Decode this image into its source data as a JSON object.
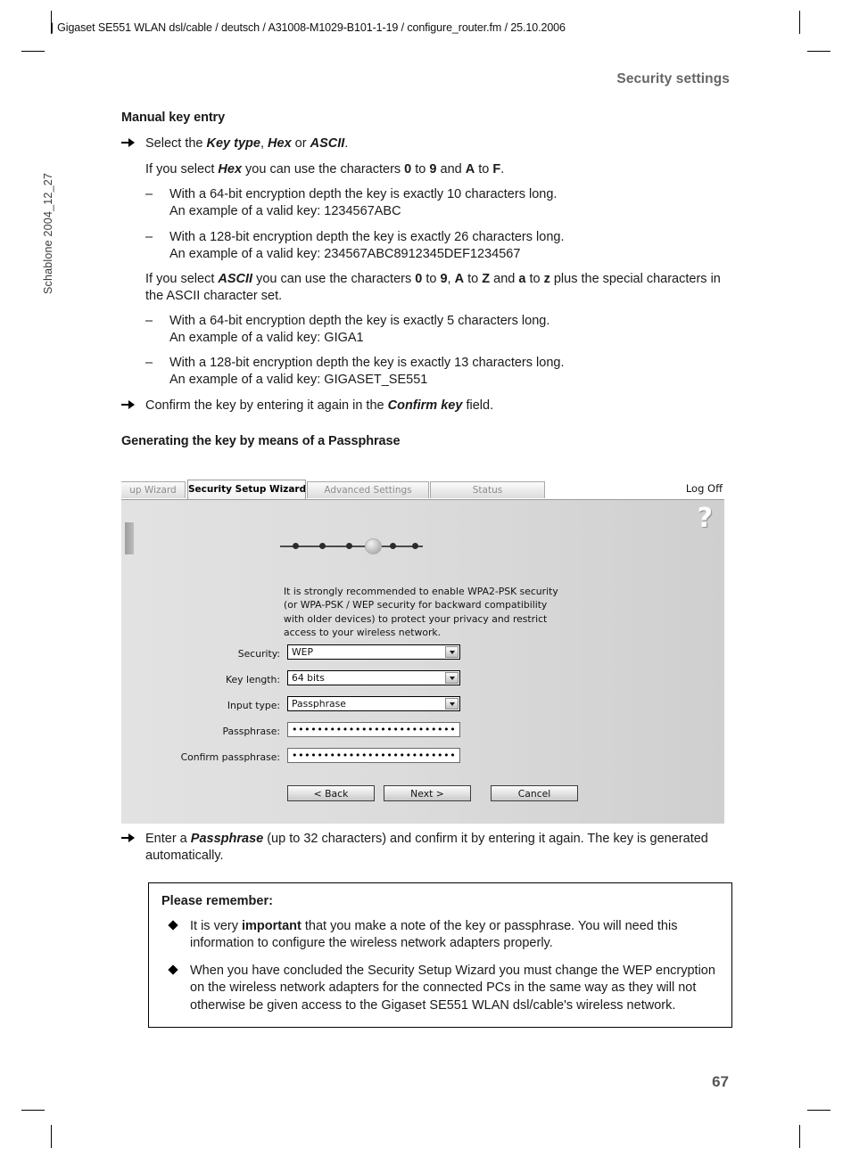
{
  "document": {
    "header_line": "Gigaset SE551 WLAN dsl/cable / deutsch / A31008-M1029-B101-1-19 / configure_router.fm / 25.10.2006",
    "running_head": "Security settings",
    "template_id": "Schablone 2004_12_27",
    "page_number": "67"
  },
  "sections": {
    "manual_key": {
      "title": "Manual key entry",
      "step_select_keytype": {
        "before": "Select the ",
        "term1": "Key type",
        "mid": ", ",
        "term2": "Hex",
        "mid2": " or ",
        "term3": "ASCII",
        "after": "."
      },
      "hex_intro_a": "If you select ",
      "hex_intro_term": "Hex",
      "hex_intro_b": " you can use the characters ",
      "hex_0": "0",
      "hex_to1": " to ",
      "hex_9": "9",
      "hex_and": " and ",
      "hex_A": "A",
      "hex_to2": " to ",
      "hex_F": "F",
      "hex_end": ".",
      "hex_items": [
        {
          "line1": "With a 64-bit encryption depth the key is exactly 10 characters long.",
          "line2": "An example of a valid key: 1234567ABC"
        },
        {
          "line1": "With a 128-bit encryption depth the key is exactly 26 characters long.",
          "line2": "An example of a valid key: 234567ABC8912345DEF1234567"
        }
      ],
      "ascii_intro_a": "If you select ",
      "ascii_intro_term": "ASCII",
      "ascii_intro_b": " you can use the characters ",
      "ascii_0": "0",
      "ascii_to1": " to ",
      "ascii_9": "9",
      "ascii_comma": ", ",
      "ascii_A": "A",
      "ascii_to2": " to ",
      "ascii_Z": "Z",
      "ascii_and": " and ",
      "ascii_a": "a",
      "ascii_to3": " to ",
      "ascii_z": "z",
      "ascii_tail": " plus the special characters in the ASCII character set.",
      "ascii_items": [
        {
          "line1": "With a 64-bit encryption depth the key is exactly 5 characters long.",
          "line2": "An example of a valid key: GIGA1"
        },
        {
          "line1": "With a 128-bit encryption depth the key is exactly 13 characters long.",
          "line2": "An example of a valid key: GIGASET_SE551"
        }
      ],
      "confirm_step_a": "Confirm the key by entering it again in the ",
      "confirm_step_term": "Confirm key",
      "confirm_step_b": " field."
    },
    "passphrase": {
      "title": "Generating the key by means of a Passphrase",
      "step_a": "Enter a ",
      "step_term": "Passphrase",
      "step_b": " (up to 32 characters) and confirm it by entering it again. The key is generated automatically."
    }
  },
  "app": {
    "tabs": [
      {
        "label": "up Wizard",
        "active": false,
        "partial": true
      },
      {
        "label": "Security Setup Wizard",
        "active": true,
        "partial": false
      },
      {
        "label": "Advanced Settings",
        "active": false,
        "partial": false
      },
      {
        "label": "Status",
        "active": false,
        "partial": false
      }
    ],
    "logoff_label": "Log Off",
    "help_icon": "question-mark-icon",
    "progress": {
      "total_steps": 6,
      "current_step": 4
    },
    "info_text": "It is strongly recommended to enable WPA2-PSK security (or WPA-PSK / WEP security for backward compatibility with older devices) to protect your privacy and restrict access to your wireless network.",
    "fields": [
      {
        "label": "Security:",
        "value": "WEP",
        "type": "select"
      },
      {
        "label": "Key length:",
        "value": "64 bits",
        "type": "select"
      },
      {
        "label": "Input type:",
        "value": "Passphrase",
        "type": "select"
      },
      {
        "label": "Passphrase:",
        "value": "••••••••••••••••••••••••••••••••",
        "type": "password"
      },
      {
        "label": "Confirm passphrase:",
        "value": "••••••••••••••••••••••••••••••••",
        "type": "password"
      }
    ],
    "buttons": [
      {
        "label": "< Back"
      },
      {
        "label": "Next >"
      },
      {
        "label": "Cancel"
      }
    ]
  },
  "remember_box": {
    "title": "Please remember:",
    "items": [
      {
        "a": "It is very ",
        "bold": "important",
        "b": " that you make a note of the key or passphrase. You will need this information to configure the wireless network adapters properly."
      },
      {
        "a": "When you have concluded the Security Setup Wizard you must change the WEP encryption on the wireless network adapters for the connected PCs in the same way as they will not otherwise be given access to the Gigaset SE551 WLAN dsl/cable's wireless network.",
        "bold": "",
        "b": ""
      }
    ]
  }
}
